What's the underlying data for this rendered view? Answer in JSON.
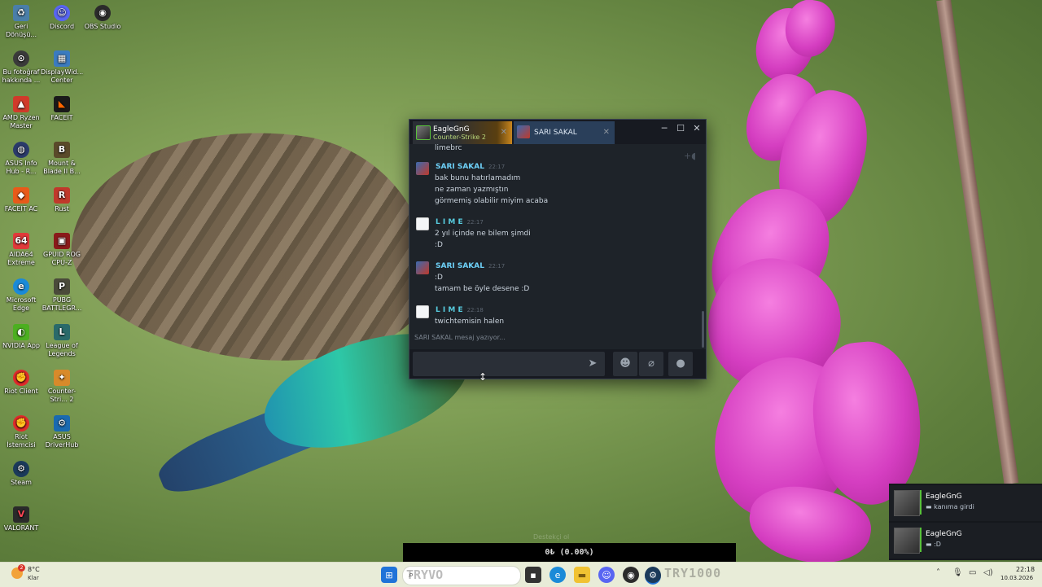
{
  "desktop": {
    "icons": [
      {
        "label": "Geri Dönüşü...",
        "icon": "recycle-bin-icon",
        "color": "#4a7ea8"
      },
      {
        "label": "Discord",
        "icon": "discord-icon",
        "color": "#5865f2"
      },
      {
        "label": "OBS Studio",
        "icon": "obs-icon",
        "color": "#2b2b2b"
      },
      {
        "label": "Bu fotoğraf hakkında ...",
        "icon": "camera-icon",
        "color": "#3a3a3a"
      },
      {
        "label": "DisplayWid... Center",
        "icon": "display-icon",
        "color": "#3b7bbf"
      },
      {
        "label": "AMD Ryzen Master",
        "icon": "amd-icon",
        "color": "#d03a2a"
      },
      {
        "label": "FACEIT",
        "icon": "faceit-icon",
        "color": "#1a1a1a"
      },
      {
        "label": "ASUS Info Hub - R...",
        "icon": "asus-icon",
        "color": "#2a3a6a"
      },
      {
        "label": "Mount & Blade II B...",
        "icon": "bannerlord-icon",
        "color": "#5a4a2a"
      },
      {
        "label": "FACEIT AC",
        "icon": "faceit-ac-icon",
        "color": "#e85a1a"
      },
      {
        "label": "Rust",
        "icon": "rust-icon",
        "color": "#c0392b"
      },
      {
        "label": "AIDA64 Extreme",
        "icon": "aida64-icon",
        "color": "#e03a3a"
      },
      {
        "label": "GPUID ROG CPU-Z",
        "icon": "cpuz-icon",
        "color": "#8a1a1a"
      },
      {
        "label": "Microsoft Edge",
        "icon": "edge-icon",
        "color": "#1a8ad8"
      },
      {
        "label": "PUBG BATTLEGR...",
        "icon": "pubg-icon",
        "color": "#4a4a3a"
      },
      {
        "label": "NVIDIA App",
        "icon": "nvidia-icon",
        "color": "#4caf20"
      },
      {
        "label": "League of Legends",
        "icon": "league-icon",
        "color": "#2a6a6a"
      },
      {
        "label": "Riot Client",
        "icon": "riot-icon",
        "color": "#e02a2a"
      },
      {
        "label": "Counter-Stri... 2",
        "icon": "cs2-icon",
        "color": "#d88a2a"
      },
      {
        "label": "Riot İstemcisi",
        "icon": "riot-icon",
        "color": "#e02a2a"
      },
      {
        "label": "ASUS DriverHub",
        "icon": "asus-driverhub-icon",
        "color": "#1a6ab0"
      },
      {
        "label": "Steam",
        "icon": "steam-icon",
        "color": "#1b3a5a"
      },
      {
        "label": "VALORANT",
        "icon": "valorant-icon",
        "color": "#2a2a2a"
      }
    ]
  },
  "chat": {
    "tabs": [
      {
        "name": "EagleGnG",
        "game": "Counter-Strike 2"
      },
      {
        "name": "SARI SAKAL"
      }
    ],
    "cut_line": "limebrc",
    "messages": [
      {
        "sender": "SARI SAKAL",
        "time": "22:17",
        "name_color": "#6dcff6",
        "lines": [
          "bak bunu hatırlamadım",
          "ne zaman yazmıştın",
          "görmemiş olabilir miyim acaba"
        ]
      },
      {
        "sender": "L I M E",
        "time": "22:17",
        "name_color": "#57cbde",
        "lines": [
          "2 yıl içinde ne bilem şimdi",
          ":D"
        ]
      },
      {
        "sender": "SARI SAKAL",
        "time": "22:17",
        "name_color": "#6dcff6",
        "lines": [
          ":D",
          "tamam be öyle desene :D"
        ]
      },
      {
        "sender": "L I M E",
        "time": "22:18",
        "name_color": "#57cbde",
        "lines": [
          "twichtemisin halen"
        ]
      }
    ],
    "typing": "SARI SAKAL mesaj yazıyor..."
  },
  "notifications": [
    {
      "name": "EagleGnG",
      "text": "kanıma girdi"
    },
    {
      "name": "EagleGnG",
      "text": ":D"
    }
  ],
  "overlay": {
    "counter": "0₺ (0.00%)",
    "faint": "Destekçi ol"
  },
  "taskbar": {
    "weather_temp": "8°C",
    "weather_desc": "Klar",
    "weather_badge": "2",
    "search_text": "TRYVO",
    "big_text": "TRY1000",
    "time": "22:18",
    "date": "10.03.2026"
  }
}
